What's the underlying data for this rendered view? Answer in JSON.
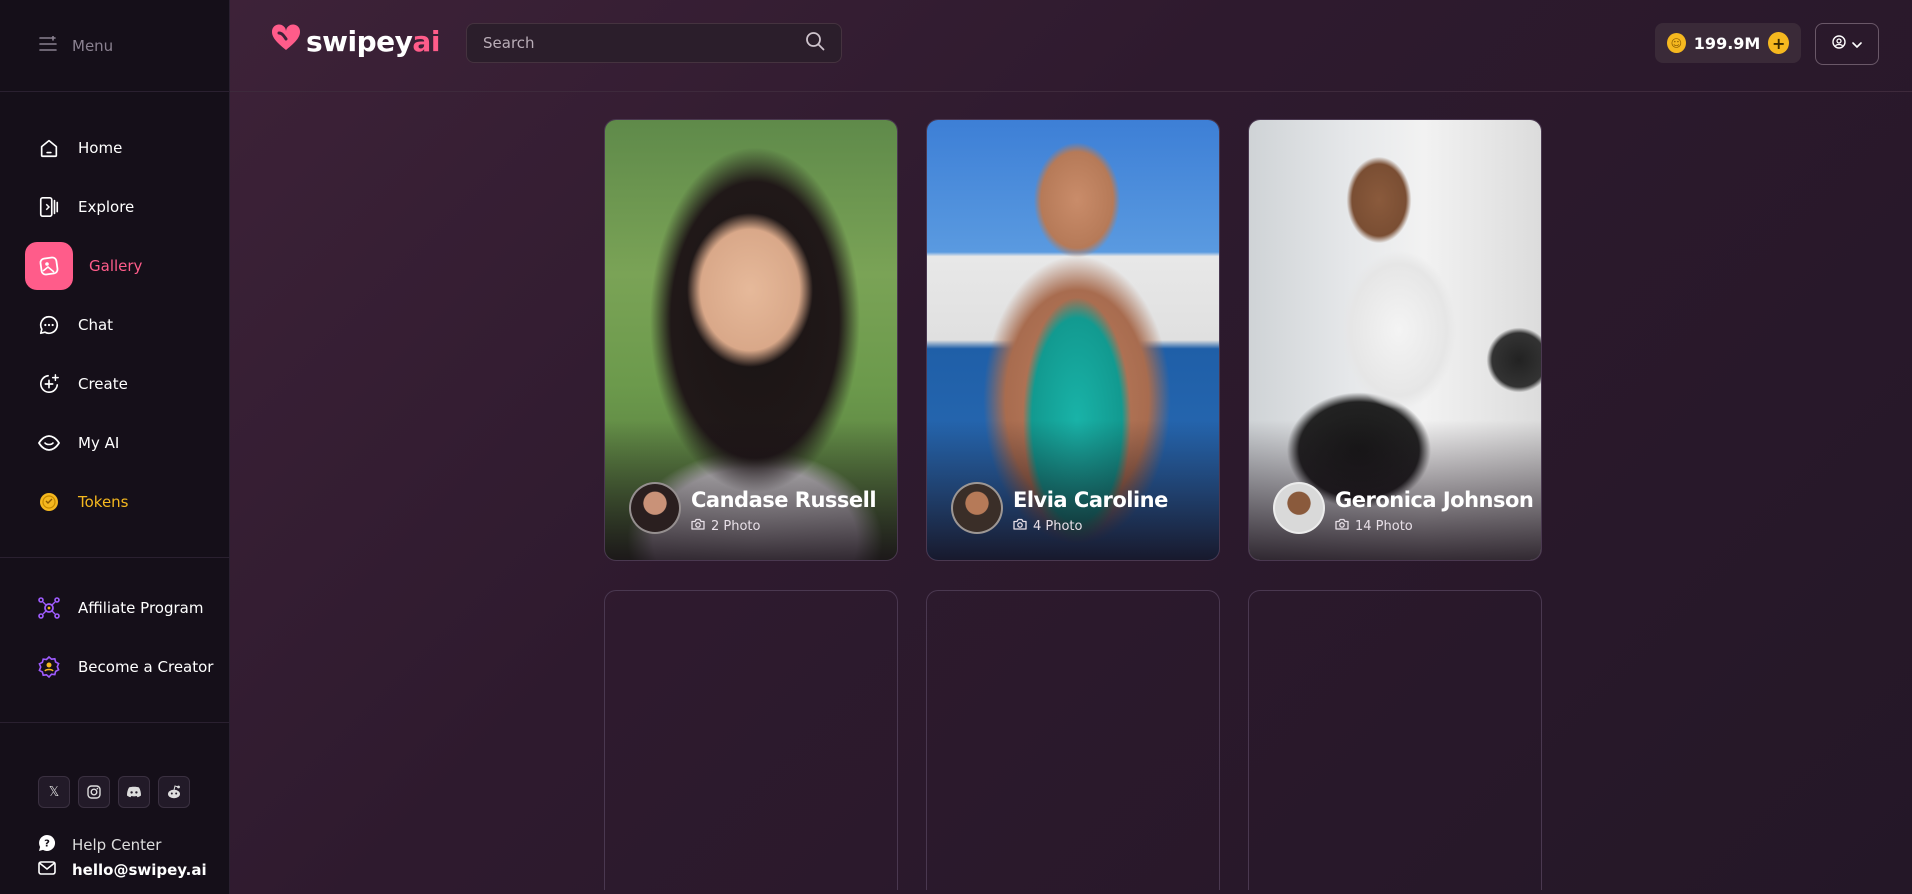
{
  "sidebar": {
    "menu_label": "Menu",
    "items": [
      {
        "label": "Home",
        "icon": "home-icon"
      },
      {
        "label": "Explore",
        "icon": "explore-icon"
      },
      {
        "label": "Gallery",
        "icon": "gallery-icon",
        "active": true
      },
      {
        "label": "Chat",
        "icon": "chat-icon"
      },
      {
        "label": "Create",
        "icon": "create-icon"
      },
      {
        "label": "My AI",
        "icon": "my-ai-icon"
      },
      {
        "label": "Tokens",
        "icon": "token-icon"
      }
    ],
    "secondary": [
      {
        "label": "Affiliate Program",
        "icon": "affiliate-icon"
      },
      {
        "label": "Become a Creator",
        "icon": "creator-icon"
      }
    ],
    "help_label": "Help Center",
    "email": "hello@swipey.ai"
  },
  "header": {
    "logo_part1": "swipey",
    "logo_part2": "ai",
    "search_placeholder": "Search",
    "balance": "199.9M"
  },
  "gallery": {
    "cards": [
      {
        "name": "Candase Russell",
        "photos": "2 Photo"
      },
      {
        "name": "Elvia Caroline",
        "photos": "4 Photo"
      },
      {
        "name": "Geronica Johnson",
        "photos": "14 Photo"
      }
    ]
  },
  "colors": {
    "accent": "#ff5c8a",
    "token": "#f5b81f",
    "sidebar_bg": "#150f19"
  }
}
